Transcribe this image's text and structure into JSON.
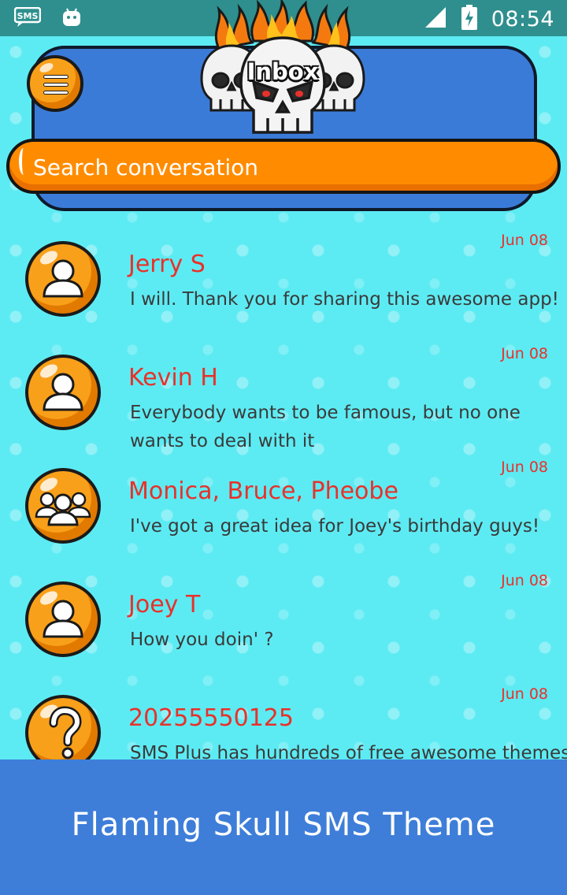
{
  "status_bar": {
    "time": "08:54",
    "icons": [
      "sms-notification-icon",
      "android-icon",
      "signal-icon",
      "battery-charging-icon"
    ]
  },
  "header": {
    "title": "Inbox",
    "menu_icon": "hamburger-menu-icon",
    "decoration": "flaming-skulls-icon"
  },
  "search": {
    "placeholder": "Search conversation"
  },
  "conversations": [
    {
      "name": "Jerry S",
      "date": "Jun 08",
      "snippet": "I will. Thank you for sharing this awesome app!",
      "avatar": "person-icon"
    },
    {
      "name": "Kevin H",
      "date": "Jun 08",
      "snippet": "Everybody wants to be famous, but no one wants to deal with it",
      "avatar": "person-icon"
    },
    {
      "name": "Monica, Bruce, Pheobe",
      "date": "Jun 08",
      "snippet": "I've got a great idea for Joey's birthday guys!",
      "avatar": "group-icon"
    },
    {
      "name": "Joey T",
      "date": "Jun 08",
      "snippet": "How you doin' ?",
      "avatar": "person-icon"
    },
    {
      "name": "20255550125",
      "date": "Jun 08",
      "snippet": "SMS Plus has hundreds of free awesome themes",
      "avatar": "unknown-contact-icon"
    }
  ],
  "footer": {
    "title": "Flaming Skull SMS Theme"
  },
  "colors": {
    "background": "#5DEBF3",
    "status_bar": "#2E8F8E",
    "header_panel": "#3B7BD8",
    "accent_orange": "#FF8C00",
    "name_red": "#E8312A",
    "footer_blue": "#3E7ED9"
  }
}
